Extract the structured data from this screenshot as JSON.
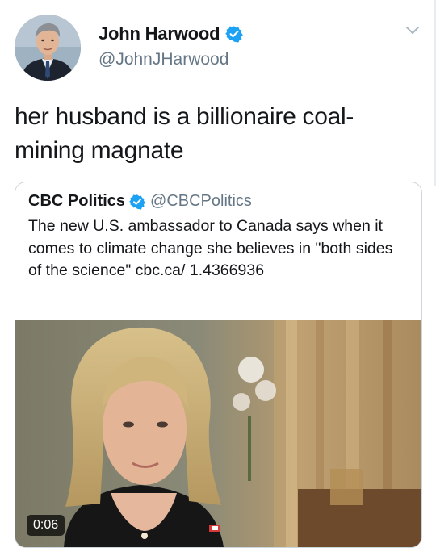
{
  "tweet": {
    "author": {
      "display_name": "John Harwood",
      "handle": "@JohnJHarwood",
      "verified": true
    },
    "text": "her husband is a billionaire coal-mining magnate",
    "menu_icon": "chevron-down-icon"
  },
  "quoted_tweet": {
    "author": {
      "display_name": "CBC Politics",
      "handle": "@CBCPolitics",
      "verified": true
    },
    "text": "The new U.S. ambassador to Canada says when it comes to climate change she believes in \"both sides of the science\" cbc.ca/ 1.4366936",
    "media": {
      "type": "video",
      "duration": "0:06"
    }
  },
  "colors": {
    "verified_blue": "#1da1f2",
    "text_primary": "#14171a",
    "text_secondary": "#657786",
    "border": "#ccd6dd"
  }
}
